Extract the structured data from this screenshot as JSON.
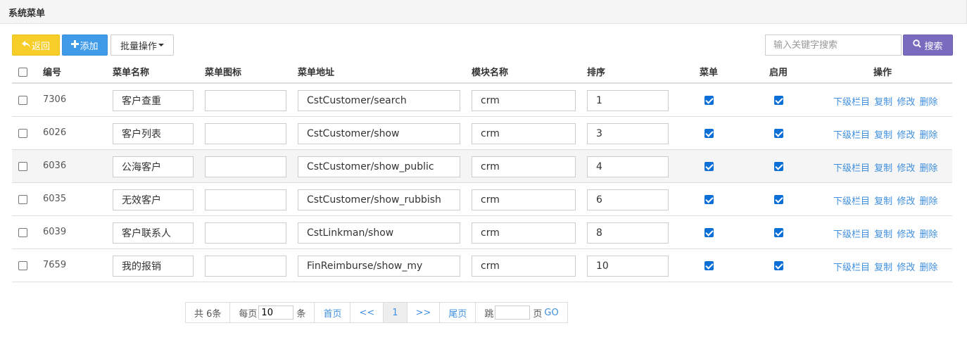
{
  "header": {
    "title": "系统菜单"
  },
  "toolbar": {
    "back_label": "返回",
    "add_label": "添加",
    "batch_label": "批量操作",
    "search_placeholder": "输入关键字搜索",
    "search_label": "搜索"
  },
  "table": {
    "columns": [
      "编号",
      "菜单名称",
      "菜单图标",
      "菜单地址",
      "模块名称",
      "排序",
      "菜单",
      "启用",
      "操作"
    ],
    "rows": [
      {
        "id": "7306",
        "name": "客户查重",
        "icon": "",
        "url": "CstCustomer/search",
        "module": "crm",
        "sort": "1",
        "menu": true,
        "enabled": true
      },
      {
        "id": "6026",
        "name": "客户列表",
        "icon": "",
        "url": "CstCustomer/show",
        "module": "crm",
        "sort": "3",
        "menu": true,
        "enabled": true
      },
      {
        "id": "6036",
        "name": "公海客户",
        "icon": "",
        "url": "CstCustomer/show_public",
        "module": "crm",
        "sort": "4",
        "menu": true,
        "enabled": true
      },
      {
        "id": "6035",
        "name": "无效客户",
        "icon": "",
        "url": "CstCustomer/show_rubbish",
        "module": "crm",
        "sort": "6",
        "menu": true,
        "enabled": true
      },
      {
        "id": "6039",
        "name": "客户联系人",
        "icon": "",
        "url": "CstLinkman/show",
        "module": "crm",
        "sort": "8",
        "menu": true,
        "enabled": true
      },
      {
        "id": "7659",
        "name": "我的报销",
        "icon": "",
        "url": "FinReimburse/show_my",
        "module": "crm",
        "sort": "10",
        "menu": true,
        "enabled": true
      }
    ],
    "row_actions": [
      "下级栏目",
      "复制",
      "修改",
      "删除"
    ]
  },
  "pagination": {
    "total": "共 6条",
    "per_page_prefix": "每页",
    "per_page_value": "10",
    "per_page_suffix": "条",
    "first": "首页",
    "prev": "<<",
    "current": "1",
    "next": ">>",
    "last": "尾页",
    "jump_prefix": "跳",
    "jump_value": "",
    "jump_suffix": "页",
    "go": "GO"
  },
  "colors": {
    "back": "#f7cd2a",
    "add": "#3f9ae8",
    "search": "#7a6bbf",
    "link": "#3f8fde"
  }
}
